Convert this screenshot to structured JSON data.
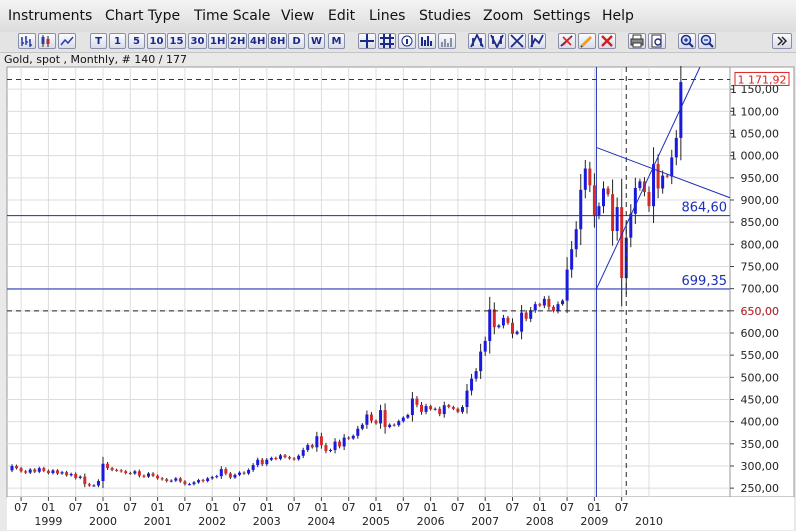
{
  "menu": [
    "Instruments",
    "Chart Type",
    "Time Scale",
    "View",
    "Edit",
    "Lines",
    "Studies",
    "Zoom",
    "Settings",
    "Help"
  ],
  "toolbar": {
    "timeframes": [
      "T",
      "1",
      "5",
      "10",
      "15",
      "30",
      "1H",
      "2H",
      "4H",
      "8H",
      "D",
      "W",
      "M"
    ],
    "icons": [
      "bar-chart-icon",
      "candlestick-icon",
      "line-chart-icon",
      "crosshair-icon",
      "grid-icon",
      "info-icon",
      "time-icon",
      "volume-icon",
      "trend-up-icon",
      "trend-down-icon",
      "zoom-fit-icon",
      "zoom-range-icon",
      "delete-line-icon",
      "pencil-icon",
      "clear-icon",
      "print-icon",
      "preview-icon",
      "zoom-in-icon",
      "zoom-out-icon",
      "expand-icon"
    ]
  },
  "info": "Gold, spot , Monthly, # 140 / 177",
  "chart_data": {
    "type": "candlestick",
    "instrument": "Gold, spot",
    "timeframe": "Monthly",
    "ylim": [
      230,
      1200
    ],
    "y_ticks": [
      250,
      300,
      350,
      400,
      450,
      500,
      550,
      600,
      650,
      700,
      750,
      800,
      850,
      900,
      950,
      1000,
      1050,
      1100,
      1150
    ],
    "y_tick_labels": [
      "250,00",
      "300,00",
      "350,00",
      "400,00",
      "450,00",
      "500,00",
      "550,00",
      "600,00",
      "650,00",
      "700,00",
      "750,00",
      "800,00",
      "850,00",
      "900,00",
      "950,00",
      "1 000,00",
      "1 050,00",
      "1 100,00",
      "1 150,00"
    ],
    "x_months_labels": [
      "07",
      "01",
      "07",
      "01",
      "07",
      "01",
      "07",
      "01",
      "07",
      "01",
      "07",
      "01",
      "07",
      "01",
      "07",
      "01",
      "07",
      "01",
      "07",
      "01",
      "07",
      "01",
      "07"
    ],
    "x_year_labels": [
      "1999",
      "2000",
      "2001",
      "2002",
      "2003",
      "2004",
      "2005",
      "2006",
      "2007",
      "2008",
      "2009",
      "2010"
    ],
    "last_price_label": "1 171,92",
    "last_price": 1171.92,
    "horizontal_levels": [
      {
        "value": 864.6,
        "label": "864,60",
        "style": "solid"
      },
      {
        "value": 699.35,
        "label": "699,35",
        "style": "solid"
      },
      {
        "value": 650.0,
        "label": "650,00",
        "style": "dashed"
      }
    ],
    "colors": {
      "up": "#1a1adc",
      "down": "#d42a2a",
      "levels": "#1a2dbb",
      "grid": "#dcdcdc"
    },
    "candles": [
      {
        "o": 290,
        "c": 300
      },
      {
        "o": 300,
        "c": 295
      },
      {
        "o": 295,
        "c": 288
      },
      {
        "o": 288,
        "c": 285
      },
      {
        "o": 285,
        "c": 292
      },
      {
        "o": 292,
        "c": 287
      },
      {
        "o": 287,
        "c": 295
      },
      {
        "o": 295,
        "c": 289
      },
      {
        "o": 289,
        "c": 284
      },
      {
        "o": 284,
        "c": 290
      },
      {
        "o": 290,
        "c": 283
      },
      {
        "o": 283,
        "c": 286
      },
      {
        "o": 286,
        "c": 279
      },
      {
        "o": 279,
        "c": 282
      },
      {
        "o": 282,
        "c": 273
      },
      {
        "o": 273,
        "c": 276
      },
      {
        "o": 276,
        "c": 259
      },
      {
        "o": 259,
        "c": 256
      },
      {
        "o": 256,
        "c": 256
      },
      {
        "o": 256,
        "c": 266
      },
      {
        "o": 266,
        "c": 305
      },
      {
        "o": 305,
        "c": 295
      },
      {
        "o": 295,
        "c": 291
      },
      {
        "o": 291,
        "c": 290
      },
      {
        "o": 290,
        "c": 288
      },
      {
        "o": 288,
        "c": 284
      },
      {
        "o": 284,
        "c": 283
      },
      {
        "o": 283,
        "c": 288
      },
      {
        "o": 288,
        "c": 278
      },
      {
        "o": 278,
        "c": 276
      },
      {
        "o": 276,
        "c": 283
      },
      {
        "o": 283,
        "c": 278
      },
      {
        "o": 278,
        "c": 272
      },
      {
        "o": 272,
        "c": 270
      },
      {
        "o": 270,
        "c": 266
      },
      {
        "o": 266,
        "c": 267
      },
      {
        "o": 267,
        "c": 272
      },
      {
        "o": 272,
        "c": 265
      },
      {
        "o": 265,
        "c": 259
      },
      {
        "o": 259,
        "c": 259
      },
      {
        "o": 259,
        "c": 263
      },
      {
        "o": 263,
        "c": 268
      },
      {
        "o": 268,
        "c": 266
      },
      {
        "o": 266,
        "c": 272
      },
      {
        "o": 272,
        "c": 275
      },
      {
        "o": 275,
        "c": 277
      },
      {
        "o": 277,
        "c": 293
      },
      {
        "o": 293,
        "c": 283
      },
      {
        "o": 283,
        "c": 274
      },
      {
        "o": 274,
        "c": 280
      },
      {
        "o": 280,
        "c": 285
      },
      {
        "o": 285,
        "c": 283
      },
      {
        "o": 283,
        "c": 291
      },
      {
        "o": 291,
        "c": 302
      },
      {
        "o": 302,
        "c": 314
      },
      {
        "o": 314,
        "c": 304
      },
      {
        "o": 304,
        "c": 314
      },
      {
        "o": 314,
        "c": 318
      },
      {
        "o": 318,
        "c": 316
      },
      {
        "o": 316,
        "c": 324
      },
      {
        "o": 324,
        "c": 320
      },
      {
        "o": 320,
        "c": 317
      },
      {
        "o": 317,
        "c": 315
      },
      {
        "o": 315,
        "c": 323
      },
      {
        "o": 323,
        "c": 336
      },
      {
        "o": 336,
        "c": 347
      },
      {
        "o": 347,
        "c": 342
      },
      {
        "o": 342,
        "c": 367
      },
      {
        "o": 367,
        "c": 347
      },
      {
        "o": 347,
        "c": 334
      },
      {
        "o": 334,
        "c": 336
      },
      {
        "o": 336,
        "c": 355
      },
      {
        "o": 355,
        "c": 344
      },
      {
        "o": 344,
        "c": 364
      },
      {
        "o": 364,
        "c": 362
      },
      {
        "o": 362,
        "c": 368
      },
      {
        "o": 368,
        "c": 384
      },
      {
        "o": 384,
        "c": 393
      },
      {
        "o": 393,
        "c": 416
      },
      {
        "o": 416,
        "c": 402
      },
      {
        "o": 402,
        "c": 396
      },
      {
        "o": 396,
        "c": 426
      },
      {
        "o": 426,
        "c": 388
      },
      {
        "o": 388,
        "c": 393
      },
      {
        "o": 393,
        "c": 392
      },
      {
        "o": 392,
        "c": 401
      },
      {
        "o": 401,
        "c": 409
      },
      {
        "o": 409,
        "c": 415
      },
      {
        "o": 415,
        "c": 452
      },
      {
        "o": 452,
        "c": 438
      },
      {
        "o": 438,
        "c": 422
      },
      {
        "o": 422,
        "c": 435
      },
      {
        "o": 435,
        "c": 428
      },
      {
        "o": 428,
        "c": 429
      },
      {
        "o": 429,
        "c": 417
      },
      {
        "o": 417,
        "c": 437
      },
      {
        "o": 437,
        "c": 433
      },
      {
        "o": 433,
        "c": 429
      },
      {
        "o": 429,
        "c": 422
      },
      {
        "o": 422,
        "c": 433
      },
      {
        "o": 433,
        "c": 470
      },
      {
        "o": 470,
        "c": 497
      },
      {
        "o": 497,
        "c": 514
      },
      {
        "o": 514,
        "c": 558
      },
      {
        "o": 558,
        "c": 582
      },
      {
        "o": 582,
        "c": 653
      },
      {
        "o": 653,
        "c": 613
      },
      {
        "o": 613,
        "c": 617
      },
      {
        "o": 617,
        "c": 634
      },
      {
        "o": 634,
        "c": 623
      },
      {
        "o": 623,
        "c": 598
      },
      {
        "o": 598,
        "c": 603
      },
      {
        "o": 603,
        "c": 646
      },
      {
        "o": 646,
        "c": 632
      },
      {
        "o": 632,
        "c": 651
      },
      {
        "o": 651,
        "c": 665
      },
      {
        "o": 665,
        "c": 662
      },
      {
        "o": 662,
        "c": 677
      },
      {
        "o": 677,
        "c": 659
      },
      {
        "o": 659,
        "c": 650
      },
      {
        "o": 650,
        "c": 665
      },
      {
        "o": 665,
        "c": 673
      },
      {
        "o": 673,
        "c": 743
      },
      {
        "o": 743,
        "c": 789
      },
      {
        "o": 789,
        "c": 834
      },
      {
        "o": 834,
        "c": 923
      },
      {
        "o": 923,
        "c": 971
      },
      {
        "o": 971,
        "c": 933
      },
      {
        "o": 933,
        "c": 865
      },
      {
        "o": 865,
        "c": 886
      },
      {
        "o": 886,
        "c": 926
      },
      {
        "o": 926,
        "c": 913
      },
      {
        "o": 913,
        "c": 830
      },
      {
        "o": 830,
        "c": 884
      },
      {
        "o": 884,
        "c": 724
      },
      {
        "o": 724,
        "c": 815
      },
      {
        "o": 815,
        "c": 869
      },
      {
        "o": 869,
        "c": 927
      },
      {
        "o": 927,
        "c": 942
      },
      {
        "o": 942,
        "c": 918
      },
      {
        "o": 918,
        "c": 886
      },
      {
        "o": 886,
        "c": 981
      },
      {
        "o": 981,
        "c": 926
      },
      {
        "o": 926,
        "c": 955
      },
      {
        "o": 955,
        "c": 953
      },
      {
        "o": 953,
        "c": 996
      },
      {
        "o": 996,
        "c": 1040
      },
      {
        "o": 1040,
        "c": 1166
      }
    ]
  }
}
